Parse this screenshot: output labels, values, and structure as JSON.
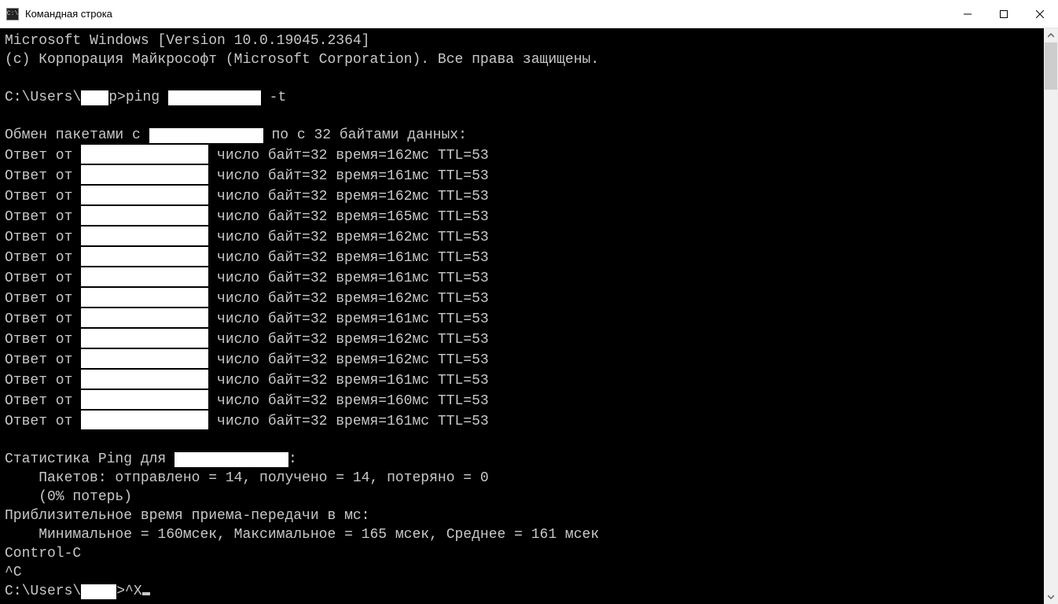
{
  "window": {
    "title": "Командная строка",
    "icon_label": "C:\\"
  },
  "output": {
    "version_line": "Microsoft Windows [Version 10.0.19045.2364]",
    "copyright_line": "(c) Корпорация Майкрософт (Microsoft Corporation). Все права защищены.",
    "prompt_prefix": "C:\\Users\\",
    "prompt_suffix_before_cmd": "p>",
    "cmd_word": "ping ",
    "cmd_flag": " -t",
    "exchange_prefix": "Обмен пакетами с ",
    "exchange_suffix": " по с 32 байтами данных:",
    "reply_prefix": "Ответ от ",
    "replies": [
      "число байт=32 время=162мс TTL=53",
      "число байт=32 время=161мс TTL=53",
      "число байт=32 время=162мс TTL=53",
      "число байт=32 время=165мс TTL=53",
      "число байт=32 время=162мс TTL=53",
      "число байт=32 время=161мс TTL=53",
      "число байт=32 время=161мс TTL=53",
      "число байт=32 время=162мс TTL=53",
      "число байт=32 время=161мс TTL=53",
      "число байт=32 время=162мс TTL=53",
      "число байт=32 время=162мс TTL=53",
      "число байт=32 время=161мс TTL=53",
      "число байт=32 время=160мс TTL=53",
      "число байт=32 время=161мс TTL=53"
    ],
    "stats_header_prefix": "Статистика Ping для ",
    "stats_header_suffix": ":",
    "stats_packets": "    Пакетов: отправлено = 14, получено = 14, потеряно = 0",
    "stats_loss": "    (0% потерь)",
    "stats_time_header": "Приблизительное время приема-передачи в мс:",
    "stats_time_values": "    Минимальное = 160мсек, Максимальное = 165 мсек, Среднее = 161 мсек",
    "ctrl_c_label": "Control-C",
    "ctrl_c_caret": "^C",
    "final_prompt_prefix": "C:\\Users\\",
    "final_prompt_tail": ">^X"
  }
}
